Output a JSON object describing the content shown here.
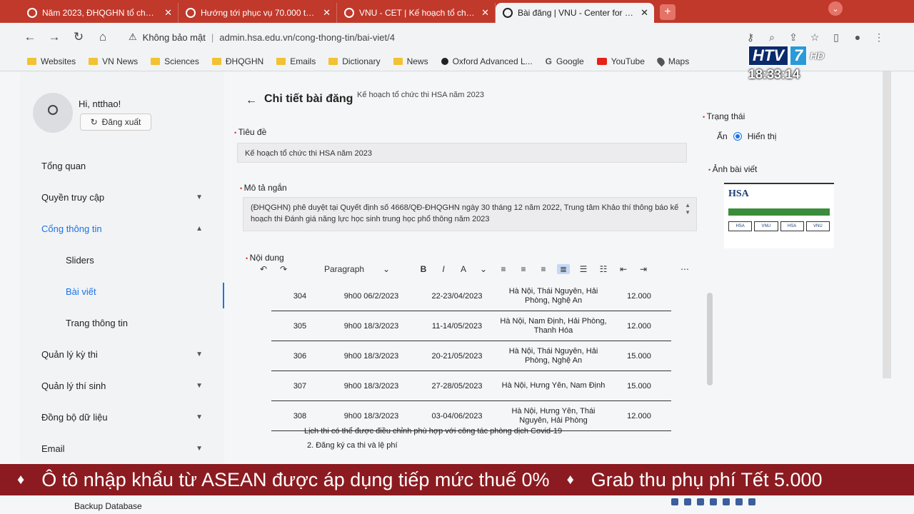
{
  "browser": {
    "tabs": [
      {
        "title": "Năm 2023, ĐHQGHN tổ chức 8 c",
        "active": false
      },
      {
        "title": "Hướng tới phục vụ 70.000 thí sin",
        "active": false
      },
      {
        "title": "VNU - CET | Kế hoạch tổ chức th",
        "active": false
      },
      {
        "title": "Bài đăng | VNU - Center for Educ",
        "active": true
      }
    ],
    "new_tab": "+",
    "address": {
      "security": "Không bảo mật",
      "url": "admin.hsa.edu.vn/cong-thong-tin/bai-viet/4"
    },
    "bookmarks": [
      {
        "label": "Websites",
        "icon": "folder"
      },
      {
        "label": "VN News",
        "icon": "folder"
      },
      {
        "label": "Sciences",
        "icon": "folder"
      },
      {
        "label": "ĐHQGHN",
        "icon": "folder"
      },
      {
        "label": "Emails",
        "icon": "folder"
      },
      {
        "label": "Dictionary",
        "icon": "folder"
      },
      {
        "label": "News",
        "icon": "folder"
      },
      {
        "label": "Oxford Advanced L...",
        "icon": "oxford"
      },
      {
        "label": "Google",
        "icon": "google"
      },
      {
        "label": "YouTube",
        "icon": "youtube"
      },
      {
        "label": "Maps",
        "icon": "maps"
      }
    ]
  },
  "sidebar": {
    "greeting": "Hi, ntthao!",
    "logout_label": "Đăng xuất",
    "items": [
      {
        "label": "Tổng quan",
        "type": "top"
      },
      {
        "label": "Quyền truy cập",
        "type": "group",
        "chevron": "⌄"
      },
      {
        "label": "Cổng thông tin",
        "type": "group-open",
        "chevron": "⌃"
      },
      {
        "label": "Sliders",
        "type": "sub"
      },
      {
        "label": "Bài viết",
        "type": "sub-active"
      },
      {
        "label": "Trang thông tin",
        "type": "sub"
      },
      {
        "label": "Quản lý kỳ thi",
        "type": "group",
        "chevron": "⌄"
      },
      {
        "label": "Quản lý thí sinh",
        "type": "group",
        "chevron": "⌄"
      },
      {
        "label": "Đồng bộ dữ liệu",
        "type": "group",
        "chevron": "⌄"
      },
      {
        "label": "Email",
        "type": "group",
        "chevron": "⌄"
      }
    ],
    "bottom_item": "Backup Database"
  },
  "main": {
    "page_title": "Chi tiết bài đăng",
    "page_subtitle": "Kế hoạch tổ chức thi HSA năm 2023",
    "title_label": "Tiêu đề",
    "title_value": "Kế hoạch tổ chức thi HSA năm 2023",
    "summary_label": "Mô tả ngắn",
    "summary_value": "(ĐHQGHN) phê duyệt tại Quyết định số 4668/QĐ-ĐHQGHN ngày 30 tháng 12 năm 2022, Trung tâm Khảo thí thông báo kế hoạch thi Đánh giá năng lực học sinh trung học phổ thông năm 2023",
    "content_label": "Nội dung",
    "editor": {
      "paragraph_label": "Paragraph",
      "rows": [
        {
          "code": "304",
          "reg": "9h00  06/2/2023",
          "date": "22-23/04/2023",
          "place": "Hà Nội, Thái Nguyên, Hải Phòng, Nghệ An",
          "qty": "12.000"
        },
        {
          "code": "305",
          "reg": "9h00  18/3/2023",
          "date": "11-14/05/2023",
          "place": "Hà Nội, Nam Định, Hải Phòng, Thanh Hóa",
          "qty": "12.000"
        },
        {
          "code": "306",
          "reg": "9h00  18/3/2023",
          "date": "20-21/05/2023",
          "place": "Hà Nội, Thái Nguyên, Hải Phòng, Nghệ An",
          "qty": "15.000"
        },
        {
          "code": "307",
          "reg": "9h00  18/3/2023",
          "date": "27-28/05/2023",
          "place": "Hà Nội, Hưng Yên, Nam Định",
          "qty": "15.000"
        },
        {
          "code": "308",
          "reg": "9h00  18/3/2023",
          "date": "03-04/06/2023",
          "place": "Hà Nội, Hưng Yên, Thái Nguyên, Hải Phòng",
          "qty": "12.000"
        }
      ],
      "note": "Lịch thi có thể được điều chỉnh phù hợp với công tác phòng dịch Covid-19",
      "note2": "2.   Đăng ký ca thi và lệ phí"
    }
  },
  "right": {
    "status_label": "Trạng thái",
    "hide_label": "Ẩn",
    "show_label": "Hiển thị",
    "image_label": "Ảnh bài viết",
    "thumb_brand": "HSA",
    "thumb_cells": [
      "HSA",
      "VNU",
      "HSA",
      "VNU"
    ]
  },
  "tv": {
    "logo_left": "HTV",
    "logo_num": "7",
    "logo_hd": "HD",
    "time": "18:33:14",
    "ticker_logo": "♦",
    "ticker_1": "Ô tô nhập khẩu từ ASEAN được áp dụng tiếp mức thuế 0%",
    "ticker_2": "Grab thu phụ phí Tết 5.000"
  },
  "colors": {
    "tab_strip": "#c0392b",
    "accent": "#1a73e8",
    "ticker": "#8b1b20",
    "required": "#d93025"
  }
}
